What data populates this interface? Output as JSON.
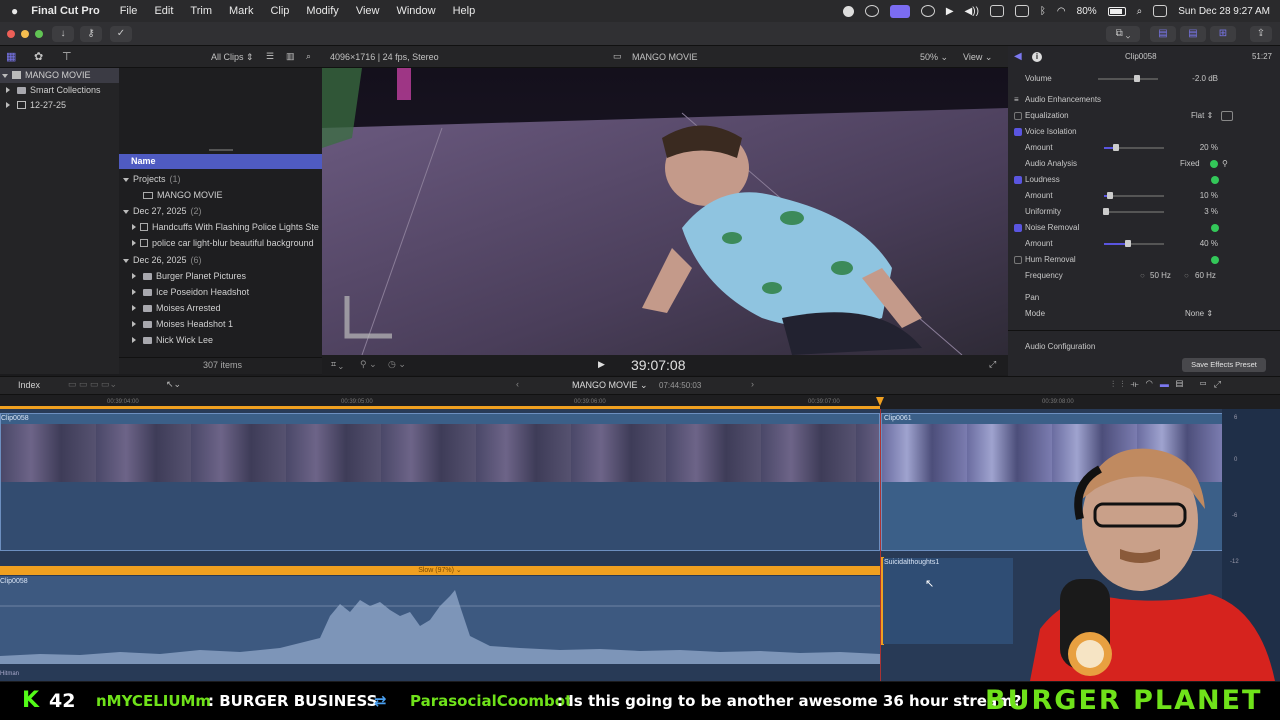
{
  "menubar": {
    "app_name": "Final Cut Pro",
    "items": [
      "File",
      "Edit",
      "Trim",
      "Mark",
      "Clip",
      "Modify",
      "View",
      "Window",
      "Help"
    ],
    "battery": "80%",
    "datetime": "Sun Dec 28  9:27 AM"
  },
  "library_bar": {
    "filter": "All Clips",
    "format_info": "4096×1716 | 24 fps, Stereo",
    "viewer_title": "MANGO MOVIE",
    "zoom": "50%",
    "view_menu": "View"
  },
  "sidebar": {
    "items": [
      {
        "label": "MANGO MOVIE"
      },
      {
        "label": "Smart Collections"
      },
      {
        "label": "12-27-25"
      }
    ]
  },
  "browser": {
    "column_header": "Name",
    "sections": [
      {
        "title": "Projects",
        "count": "(1)",
        "items": [
          "MANGO MOVIE"
        ]
      },
      {
        "title": "Dec 27, 2025",
        "count": "(2)",
        "items": [
          "Handcuffs With Flashing Police Lights Ste",
          "police car light-blur beautiful background"
        ]
      },
      {
        "title": "Dec 26, 2025",
        "count": "(6)",
        "items": [
          "Burger Planet Pictures",
          "Ice Poseidon Headshot",
          "Moises Arrested",
          "Moises Headshot 1",
          "Nick Wick Lee"
        ]
      }
    ],
    "item_count": "307 items"
  },
  "viewer": {
    "timecode": "39:07:08"
  },
  "inspector": {
    "clip_name": "Clip0058",
    "duration": "51:27",
    "volume_label": "Volume",
    "volume_value": "-2.0",
    "volume_unit": "dB",
    "enhancements_title": "Audio Enhancements",
    "equalization_label": "Equalization",
    "equalization_value": "Flat",
    "voice_isolation_label": "Voice Isolation",
    "vi_amount_label": "Amount",
    "vi_amount_value": "20",
    "analysis_label": "Audio Analysis",
    "analysis_value": "Fixed",
    "loudness_label": "Loudness",
    "loud_amount_label": "Amount",
    "loud_amount_value": "10",
    "uniformity_label": "Uniformity",
    "uniformity_value": "3",
    "noise_label": "Noise Removal",
    "noise_amount_label": "Amount",
    "noise_amount_value": "40",
    "hum_label": "Hum Removal",
    "frequency_label": "Frequency",
    "freq_50": "50",
    "freq_60": "60",
    "hz": "Hz",
    "pct": "%",
    "pan_title": "Pan",
    "mode_label": "Mode",
    "mode_value": "None",
    "config_label": "Audio Configuration",
    "save_preset": "Save Effects Preset",
    "levels": {
      "vi_amount": 0.2,
      "loud_amount": 0.1,
      "uniformity": 0.03,
      "noise_amount": 0.4
    }
  },
  "timeline_bar": {
    "index_label": "Index",
    "project_name": "MANGO MOVIE",
    "project_timecode": "07:44:50:03"
  },
  "ruler": {
    "ticks": [
      "00:39:04:00",
      "00:39:05:00",
      "00:39:06:00",
      "00:39:07:00",
      "00:39:08:00"
    ]
  },
  "timeline": {
    "clip_a": "Clip0058",
    "clip_b": "Clip0061",
    "audio_clip": "Clip0058",
    "retime_label": "Slow (97%)",
    "side_clip": "Suicidalthoughts1",
    "lower_label": "Hitman",
    "meter_labels": [
      "6",
      "0",
      "-6",
      "-12"
    ]
  },
  "chat": {
    "k_count": "42",
    "user1": "nMYCELIUMm",
    "msg1": ": BURGER BUSINESS",
    "user2": "ParasocialCoombot",
    "msg2": ": Is this going to be another awesome 36 hour stream?",
    "brand": "BURGER PLANET"
  },
  "colors": {
    "accent": "#5a55e0",
    "orange": "#f0a020",
    "timeline_bg": "#283a56",
    "browser_selection": "#4f5bc2",
    "chat_green": "#6fe21a"
  }
}
